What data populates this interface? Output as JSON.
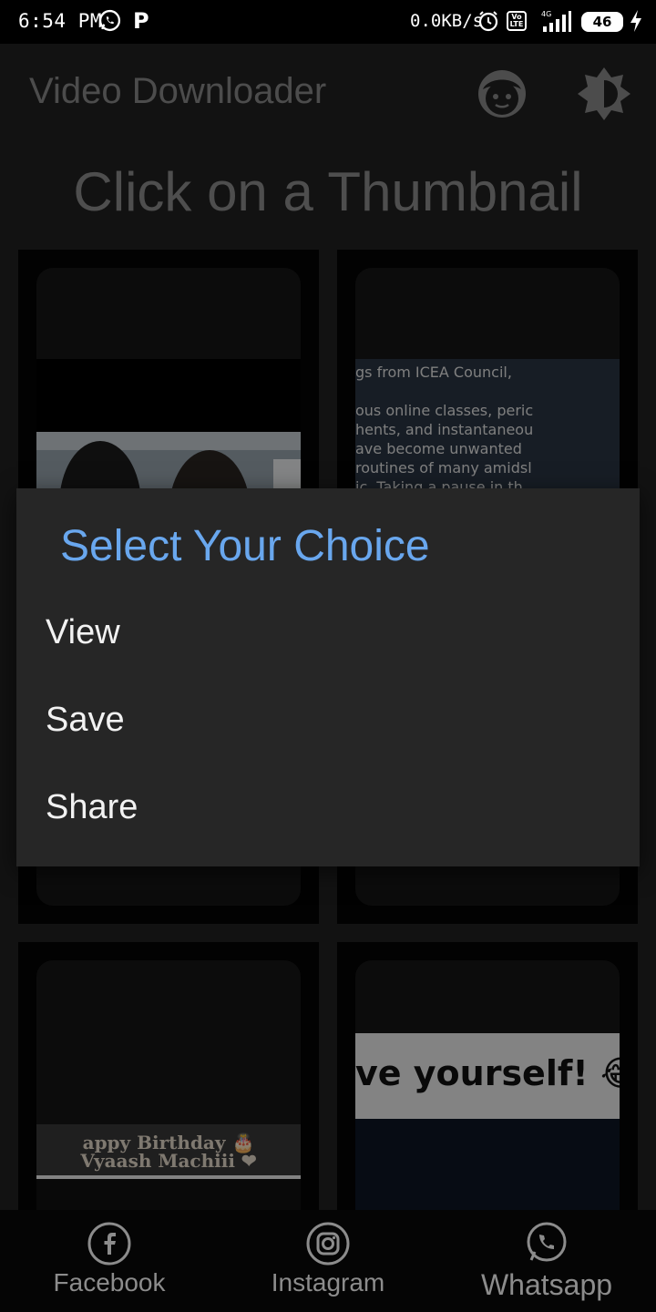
{
  "status_bar": {
    "time": "6:54 PM",
    "network_speed": "0.0KB/s",
    "battery": "46",
    "volte": "Vo LTE",
    "signal_type": "4G"
  },
  "app_bar": {
    "title": "Video Downloader",
    "face_icon": "face-icon",
    "theme_icon": "brightness-icon"
  },
  "main": {
    "heading": "Click on a Thumbnail",
    "thumbnails": [
      {
        "caption_lines": []
      },
      {
        "caption_lines": [
          "gs from ICEA Council,",
          "ous online classes, peric",
          "hents, and instantaneou",
          "ave become unwanted",
          "routines of many amidsl",
          "ic. Taking a pause in th"
        ]
      },
      {
        "caption_lines": [
          "appy Birthday 🎂",
          "Vyaash Machiii ❤"
        ]
      },
      {
        "caption_lines": [
          "ve yourself! 😂"
        ]
      }
    ]
  },
  "dialog": {
    "title": "Select Your Choice",
    "options": [
      "View",
      "Save",
      "Share"
    ]
  },
  "bottom_nav": {
    "items": [
      {
        "label": "Facebook",
        "icon": "facebook-icon"
      },
      {
        "label": "Instagram",
        "icon": "instagram-icon"
      },
      {
        "label": "Whatsapp",
        "icon": "whatsapp-icon"
      }
    ]
  },
  "colors": {
    "accent": "#69a7ee",
    "background": "#222222",
    "dialog_background": "#262626"
  }
}
